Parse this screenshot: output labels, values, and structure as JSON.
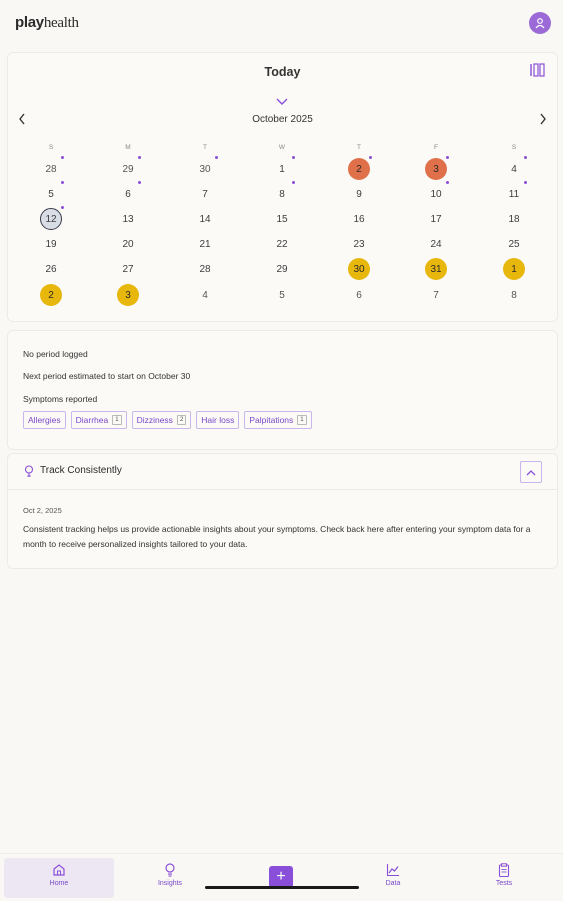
{
  "header": {
    "logo_part1": "play",
    "logo_part2": "health"
  },
  "calendar": {
    "title": "Today",
    "month_label": "October 2025",
    "weekdays": [
      "S",
      "M",
      "T",
      "W",
      "T",
      "F",
      "S"
    ],
    "weeks": [
      [
        "28",
        "29",
        "30",
        "1",
        "2",
        "3",
        "4"
      ],
      [
        "5",
        "6",
        "7",
        "8",
        "9",
        "10",
        "11"
      ],
      [
        "12",
        "13",
        "14",
        "15",
        "16",
        "17",
        "18"
      ],
      [
        "19",
        "20",
        "21",
        "22",
        "23",
        "24",
        "25"
      ],
      [
        "26",
        "27",
        "28",
        "29",
        "30",
        "31",
        "1"
      ],
      [
        "2",
        "3",
        "4",
        "5",
        "6",
        "7",
        "8"
      ]
    ],
    "period_days": [
      "2",
      "3"
    ],
    "estimated_days": [
      "30",
      "31",
      "1",
      "2",
      "3"
    ],
    "today": "12"
  },
  "info": {
    "period_status": "No period logged",
    "next_period": "Next period estimated to start on October 30",
    "symptoms_label": "Symptoms reported",
    "symptoms": [
      {
        "name": "Allergies",
        "count": ""
      },
      {
        "name": "Diarrhea",
        "count": "1"
      },
      {
        "name": "Dizziness",
        "count": "2"
      },
      {
        "name": "Hair loss",
        "count": ""
      },
      {
        "name": "Palpitations",
        "count": "1"
      }
    ]
  },
  "track": {
    "title": "Track Consistently",
    "date": "Oct 2, 2025",
    "body": "Consistent tracking helps us provide actionable insights about your symptoms. Check back here after entering your symptom data for a month to receive personalized insights tailored to your data."
  },
  "nav": {
    "home": "Home",
    "insights": "Insights",
    "add": "+",
    "data": "Data",
    "tests": "Tests"
  },
  "colors": {
    "accent": "#8a4fd8",
    "period": "#e0704a",
    "estimated": "#e8b70c",
    "background": "#faf8f4"
  },
  "icons": [
    "user-icon",
    "layout-columns-icon",
    "chevron-down-icon",
    "chevron-left-icon",
    "chevron-right-icon",
    "lightbulb-icon",
    "chevron-up-icon",
    "home-icon",
    "chart-line-icon",
    "clipboard-icon",
    "plus-icon"
  ]
}
